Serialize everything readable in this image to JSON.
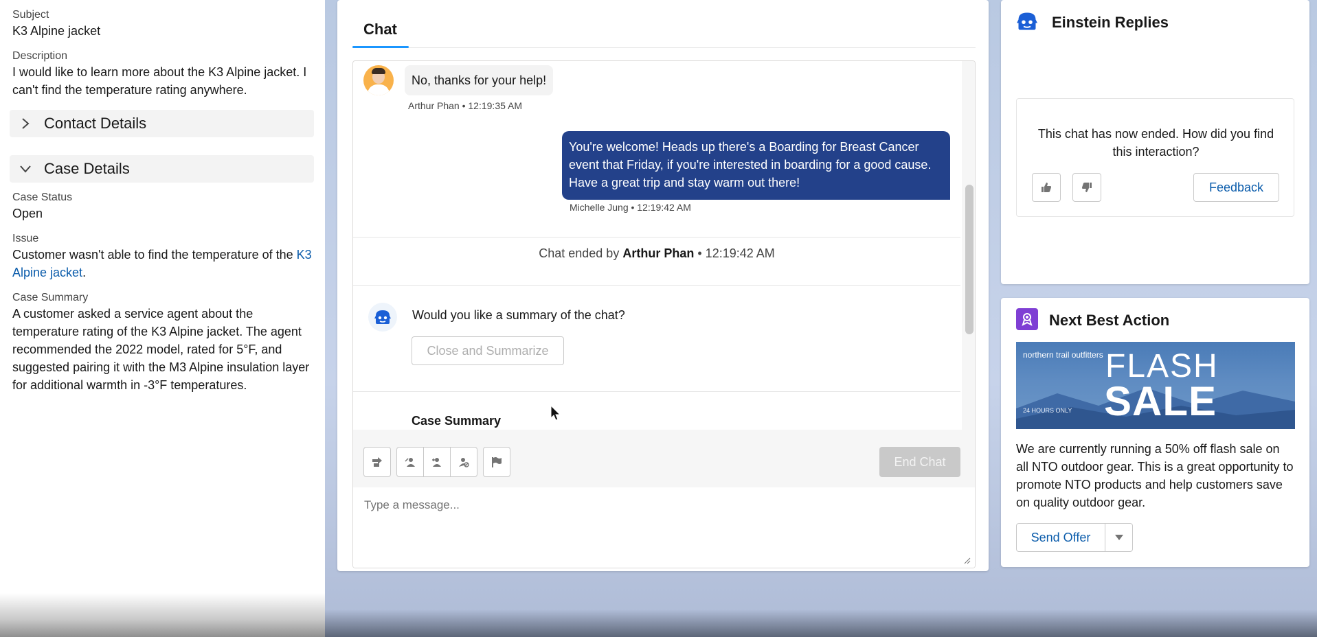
{
  "left_panel": {
    "subject_label": "Subject",
    "subject_value": "K3 Alpine jacket",
    "description_label": "Description",
    "description_value": "I would like to learn more about the K3 Alpine jacket. I can't find the temperature rating anywhere.",
    "contact_details_title": "Contact Details",
    "case_details_title": "Case Details",
    "case_status_label": "Case Status",
    "case_status_value": "Open",
    "issue_label": "Issue",
    "issue_text": "Customer wasn't able to find the temperature of the",
    "issue_link": "K3 Alpine jacket",
    "issue_period": ".",
    "case_summary_label": "Case Summary",
    "case_summary_value": "A customer asked a service agent about the temperature rating of the K3 Alpine jacket. The agent recommended the 2022 model, rated for 5°F, and suggested pairing it with the M3 Alpine insulation layer for additional warmth in -3°F temperatures."
  },
  "chat": {
    "tab_label": "Chat",
    "incoming_message": "No, thanks for your help!",
    "incoming_meta": "Arthur Phan • 12:19:35 AM",
    "outgoing_message": "You're welcome! Heads up there's a Boarding for Breast Cancer event that Friday, if you're interested in boarding for a good cause. Have a great trip and stay warm out there!",
    "outgoing_meta": "Michelle Jung • 12:19:42 AM",
    "ended_prefix": "Chat ended by",
    "ended_name": "Arthur Phan",
    "ended_time": "• 12:19:42 AM",
    "bot_question": "Would you like a summary of the chat?",
    "summarize_button": "Close and Summarize",
    "case_summary_heading": "Case Summary",
    "end_chat_button": "End Chat",
    "composer_placeholder": "Type a message..."
  },
  "einstein": {
    "title": "Einstein Replies",
    "feedback_question": "This chat has now ended. How did you find this interaction?",
    "feedback_button": "Feedback"
  },
  "next_best_action": {
    "title": "Next Best Action",
    "banner_logo": "northern trail outfitters",
    "banner_flash": "FLASH",
    "banner_sale": "SALE",
    "banner_hours": "24 HOURS ONLY",
    "description": "We are currently running a 50% off flash sale on all NTO outdoor gear. This is a great opportunity to promote NTO products and help customers save on quality outdoor gear.",
    "send_offer_button": "Send Offer"
  },
  "colors": {
    "accent": "#1b96ff",
    "outgoing_bubble": "#23418a",
    "link": "#0b5cab",
    "nba_icon_bg": "#7f3fd4",
    "einstein_icon": "#1b5fd6"
  }
}
